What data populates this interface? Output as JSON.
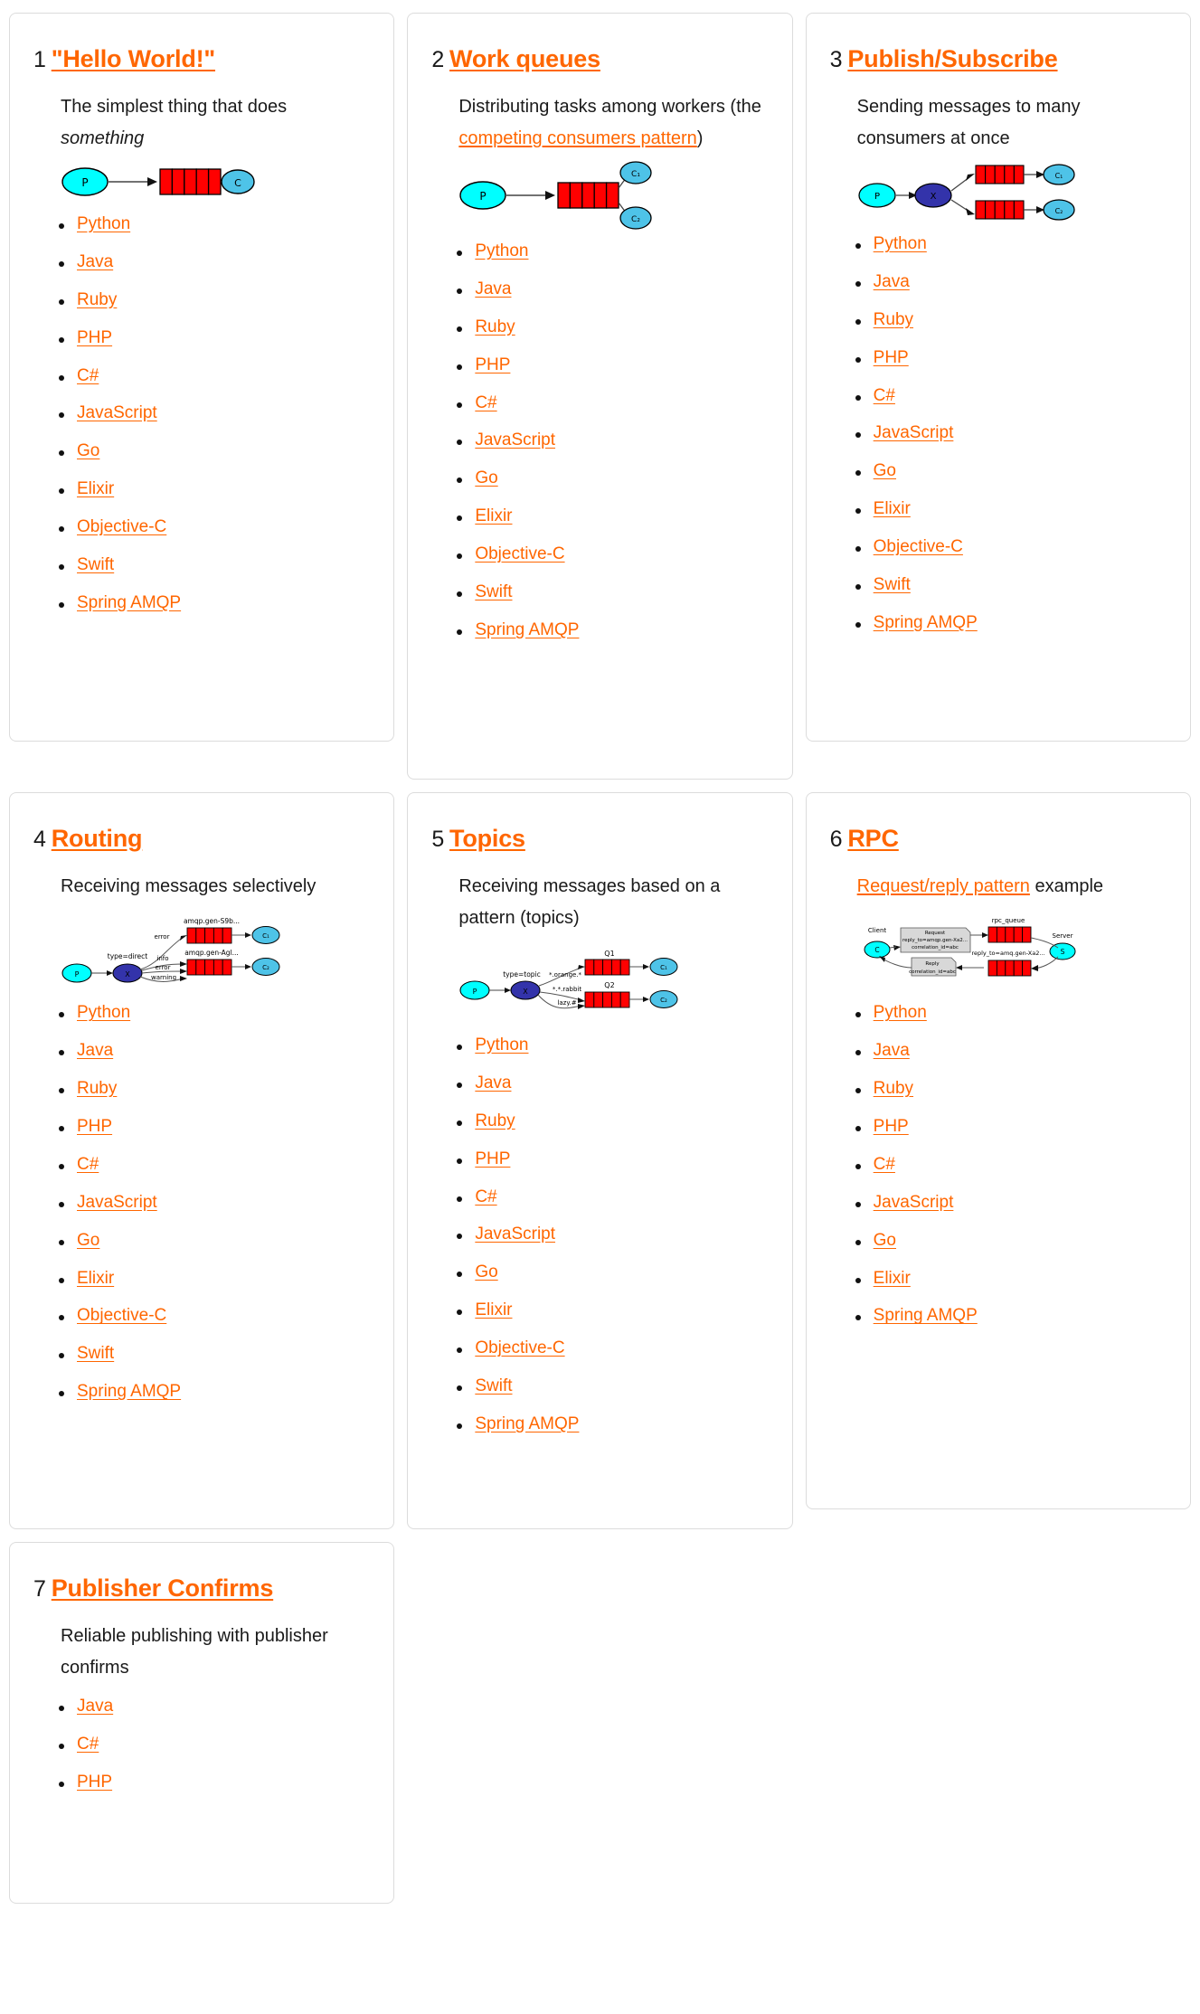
{
  "colors": {
    "accent": "#ff6600",
    "text": "#1a1a1a",
    "card_border": "#dcdcdc",
    "queue_red": "#ff0000",
    "producer_cyan": "#00ffff",
    "consumer_blue": "#4ec3e8",
    "exchange_blue": "#3333aa"
  },
  "languages_full": [
    "Python",
    "Java",
    "Ruby",
    "PHP",
    "C#",
    "JavaScript",
    "Go",
    "Elixir",
    "Objective-C",
    "Swift",
    "Spring AMQP"
  ],
  "tutorials": [
    {
      "number": "1",
      "title": "\"Hello World!\"",
      "desc_before": "The simplest thing that does ",
      "desc_em": "something",
      "desc_after": "",
      "desc_link": "",
      "languages": [
        "Python",
        "Java",
        "Ruby",
        "PHP",
        "C#",
        "JavaScript",
        "Go",
        "Elixir",
        "Objective-C",
        "Swift",
        "Spring AMQP"
      ],
      "diagram": {
        "name": "hello-world-diagram",
        "nodes": [
          "P",
          "C"
        ],
        "labels": []
      }
    },
    {
      "number": "2",
      "title": "Work queues",
      "desc_before": "Distributing tasks among workers (the ",
      "desc_link": "competing consumers pattern",
      "desc_after": ")",
      "desc_em": "",
      "languages": [
        "Python",
        "Java",
        "Ruby",
        "PHP",
        "C#",
        "JavaScript",
        "Go",
        "Elixir",
        "Objective-C",
        "Swift",
        "Spring AMQP"
      ],
      "diagram": {
        "name": "work-queues-diagram",
        "nodes": [
          "P",
          "C₁",
          "C₂"
        ],
        "labels": []
      }
    },
    {
      "number": "3",
      "title": "Publish/Subscribe",
      "desc_before": "Sending messages to many consumers at once",
      "desc_link": "",
      "desc_after": "",
      "desc_em": "",
      "languages": [
        "Python",
        "Java",
        "Ruby",
        "PHP",
        "C#",
        "JavaScript",
        "Go",
        "Elixir",
        "Objective-C",
        "Swift",
        "Spring AMQP"
      ],
      "diagram": {
        "name": "publish-subscribe-diagram",
        "nodes": [
          "P",
          "X",
          "C₁",
          "C₂"
        ],
        "labels": []
      }
    },
    {
      "number": "4",
      "title": "Routing",
      "desc_before": "Receiving messages selectively",
      "desc_link": "",
      "desc_after": "",
      "desc_em": "",
      "languages": [
        "Python",
        "Java",
        "Ruby",
        "PHP",
        "C#",
        "JavaScript",
        "Go",
        "Elixir",
        "Objective-C",
        "Swift",
        "Spring AMQP"
      ],
      "diagram": {
        "name": "routing-diagram",
        "nodes": [
          "P",
          "X",
          "C₁",
          "C₂"
        ],
        "labels": [
          "type=direct",
          "error",
          "info",
          "error",
          "warning",
          "amqp.gen-S9b...",
          "amqp.gen-Agl..."
        ]
      }
    },
    {
      "number": "5",
      "title": "Topics",
      "desc_before": "Receiving messages based on a pattern (topics)",
      "desc_link": "",
      "desc_after": "",
      "desc_em": "",
      "languages": [
        "Python",
        "Java",
        "Ruby",
        "PHP",
        "C#",
        "JavaScript",
        "Go",
        "Elixir",
        "Objective-C",
        "Swift",
        "Spring AMQP"
      ],
      "diagram": {
        "name": "topics-diagram",
        "nodes": [
          "P",
          "X",
          "C₁",
          "C₂"
        ],
        "labels": [
          "type=topic",
          "*.orange.*",
          "*.*.rabbit",
          "lazy.#",
          "Q1",
          "Q2"
        ]
      }
    },
    {
      "number": "6",
      "title": "RPC",
      "desc_before": "",
      "desc_link": "Request/reply pattern",
      "desc_after": " example",
      "desc_em": "",
      "languages": [
        "Python",
        "Java",
        "Ruby",
        "PHP",
        "C#",
        "JavaScript",
        "Go",
        "Elixir",
        "Spring AMQP"
      ],
      "diagram": {
        "name": "rpc-diagram",
        "nodes": [
          "C",
          "S"
        ],
        "labels": [
          "Client",
          "Server",
          "rpc_queue",
          "Request",
          "reply_to=amqp.gen-Xa2...",
          "correlation_id=abc",
          "Reply",
          "correlation_id=abc",
          "reply_to=amq.gen-Xa2..."
        ]
      }
    },
    {
      "number": "7",
      "title": "Publisher Confirms",
      "desc_before": "Reliable publishing with publisher confirms",
      "desc_link": "",
      "desc_after": "",
      "desc_em": "",
      "languages": [
        "Java",
        "C#",
        "PHP"
      ],
      "diagram": null
    }
  ]
}
